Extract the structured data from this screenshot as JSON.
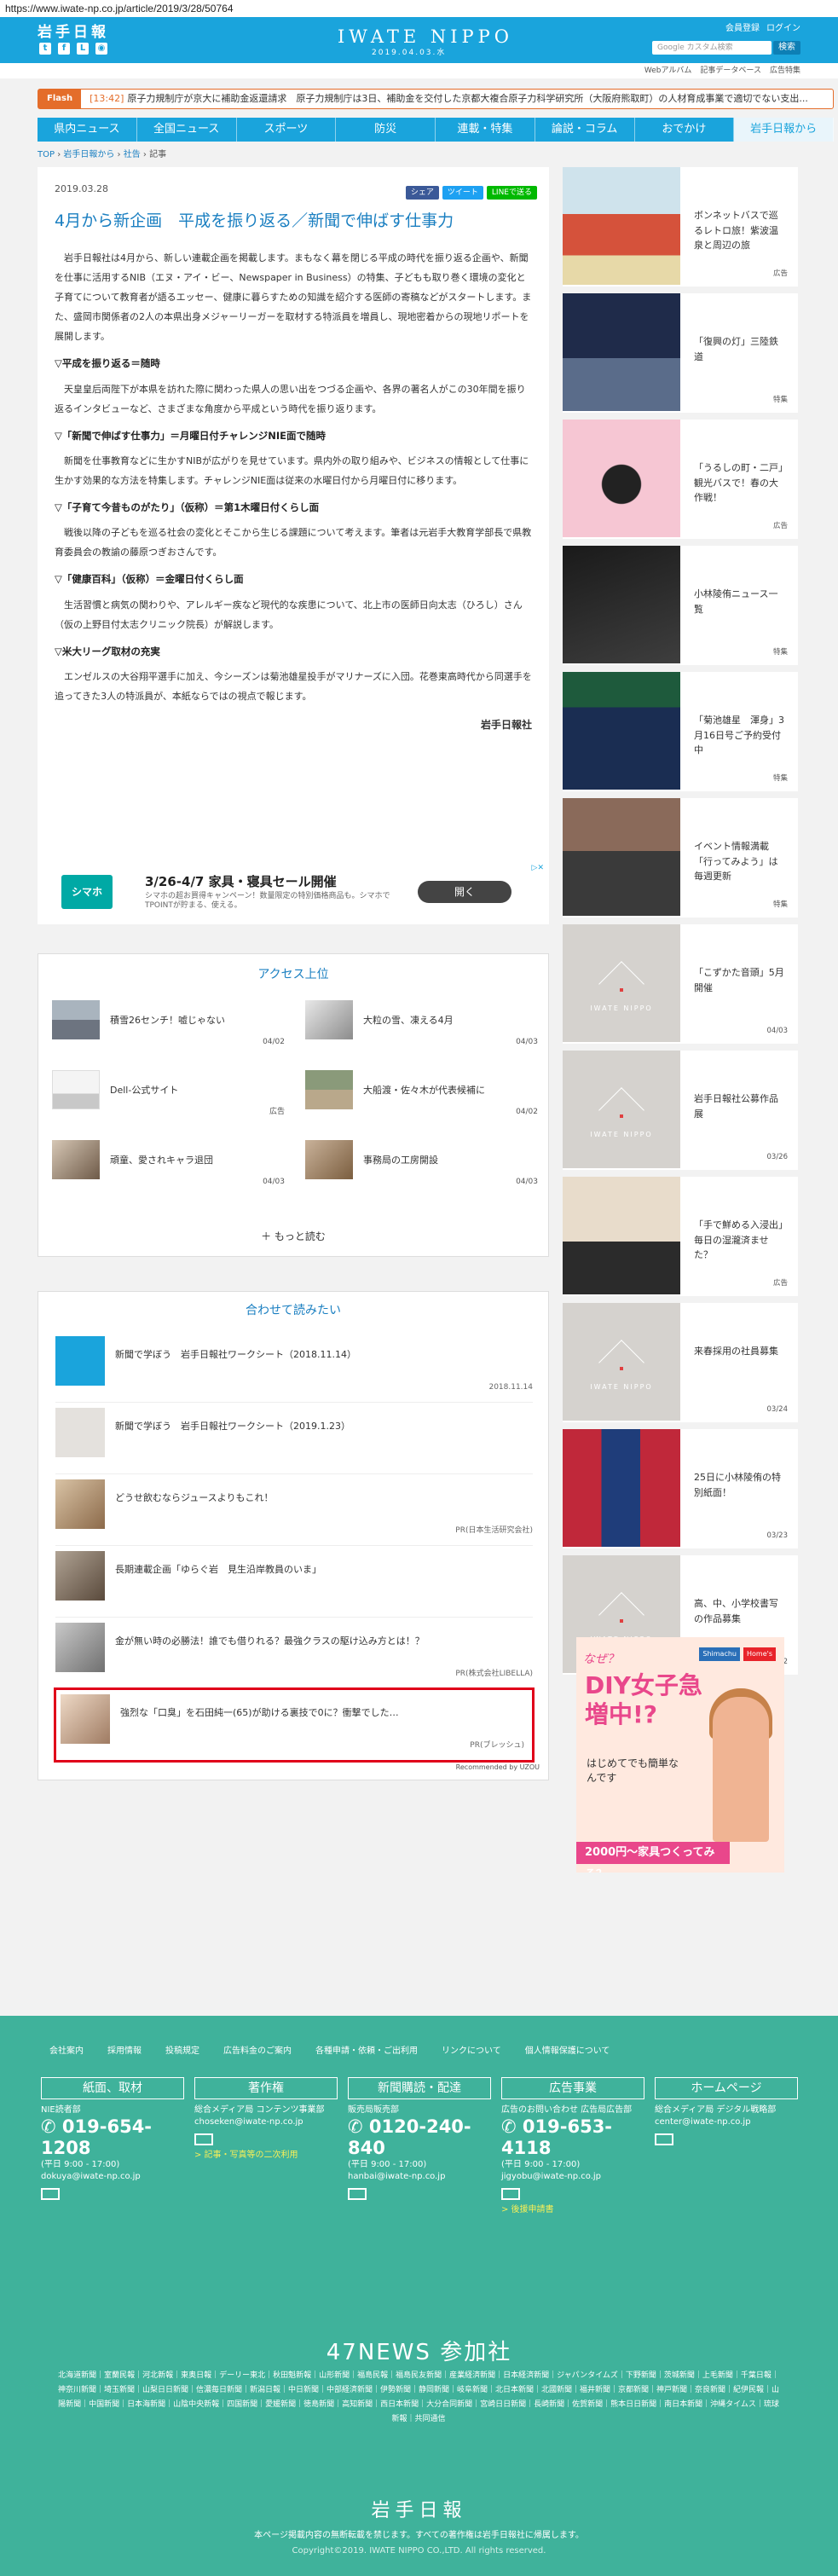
{
  "url": "https://www.iwate-np.co.jp/article/2019/3/28/50764",
  "header": {
    "logo_jp": "岩手日報",
    "logo_en": "IWATE NIPPO",
    "date": "2019.04.03.水",
    "member_register": "会員登録",
    "login": "ログイン",
    "search_placeholder": "Google カスタム検索",
    "search_button": "検索",
    "social": [
      "t",
      "f",
      "L",
      "rss"
    ]
  },
  "subnav": [
    "Webアルバム",
    "記事データベース",
    "広告特集"
  ],
  "flash": {
    "tag": "Flash",
    "time": "[13:42]",
    "text": "原子力規制庁が京大に補助金返還請求　原子力規制庁は3日、補助金を交付した京都大複合原子力科学研究所（大阪府熊取町）の人材育成事業で適切でない支出..."
  },
  "mainnav": [
    "県内ニュース",
    "全国ニュース",
    "スポーツ",
    "防災",
    "連載・特集",
    "論説・コラム",
    "おでかけ",
    "岩手日報から"
  ],
  "breadcrumb": [
    "TOP",
    "岩手日報から",
    "社告",
    "記事"
  ],
  "article": {
    "date": "2019.03.28",
    "share": [
      "シェア",
      "ツイート",
      "LINEで送る"
    ],
    "title": "4月から新企画　平成を振り返る／新聞で伸ばす仕事力",
    "intro": "岩手日報社は4月から、新しい連載企画を掲載します。まもなく幕を閉じる平成の時代を振り返る企画や、新聞を仕事に活用するNIB（エヌ・アイ・ビー、Newspaper in Business）の特集、子どもも取り巻く環境の変化と子育てについて教育者が語るエッセー、健康に暮らすための知識を紹介する医師の寄稿などがスタートします。また、盛岡市関係者の2人の本県出身メジャーリーガーを取材する特派員を増員し、現地密着からの現地リポートを展開します。",
    "sections": [
      {
        "heading": "▽平成を振り返る＝随時",
        "body": "天皇皇后両陛下が本県を訪れた際に関わった県人の思い出をつづる企画や、各界の著名人がこの30年間を振り返るインタビューなど、さまざまな角度から平成という時代を振り返ります。"
      },
      {
        "heading": "▽「新聞で伸ばす仕事力」＝月曜日付チャレンジNIE面で随時",
        "body": "新聞を仕事教育などに生かすNIBが広がりを見せています。県内外の取り組みや、ビジネスの情報として仕事に生かす効果的な方法を特集します。チャレンジNIE面は従来の水曜日付から月曜日付に移ります。"
      },
      {
        "heading": "▽「子育て今昔ものがたり」（仮称）＝第1木曜日付くらし面",
        "body": "戦後以降の子どもを巡る社会の変化とそこから生じる課題について考えます。筆者は元岩手大教育学部長で県教育委員会の教諭の藤原つぎおさんです。"
      },
      {
        "heading": "▽「健康百科」（仮称）＝金曜日付くらし面",
        "body": "生活習慣と病気の関わりや、アレルギー疾など現代的な疾患について、北上市の医師日向太志（ひろし）さん（仮の上野目付太志クリニック院長）が解説します。"
      },
      {
        "heading": "▽米大リーグ取材の充実",
        "body": "エンゼルスの大谷翔平選手に加え、今シーズンは菊池雄星投手がマリナーズに入団。花巻東高時代から同選手を追ってきた3人の特派員が、本紙ならではの視点で報じます。"
      }
    ],
    "signature": "岩手日報社"
  },
  "ad": {
    "logo": "シマホ",
    "headline": "3/26-4/7 家具・寝具セール開催",
    "desc": "シマホの超お買得キャンペーン！数量限定の特別価格商品も。シマホでTPOINTが貯まる、使える。",
    "button": "開く"
  },
  "ranking": {
    "title": "アクセス上位",
    "items": [
      {
        "label": "積雪26センチ！嘘じゃない",
        "date": "04/02"
      },
      {
        "label": "大粒の雪、凍える4月",
        "date": "04/03"
      },
      {
        "label": "Dell-公式サイト",
        "date": "広告"
      },
      {
        "label": "大船渡・佐々木が代表候補に",
        "date": "04/02"
      },
      {
        "label": "頑童、愛されキャラ退団",
        "date": "04/03"
      },
      {
        "label": "事務局の工房開設",
        "date": "04/03"
      }
    ],
    "more": "もっと読む"
  },
  "related": {
    "title": "合わせて読みたい",
    "items": [
      {
        "label": "新聞で学ぼう　岩手日報社ワークシート（2018.11.14）",
        "meta": "2018.11.14"
      },
      {
        "label": "新聞で学ぼう　岩手日報社ワークシート（2019.1.23）",
        "meta": ""
      },
      {
        "label": "どうせ飲むならジュースよりもこれ！",
        "meta": "PR(日本生活研究会社)"
      },
      {
        "label": "長期連載企画「ゆらぐ岩　見生沿岸教員のいま」",
        "meta": ""
      },
      {
        "label": "金が無い時の必勝法！誰でも借りれる？最強クラスの駆け込み方とは！？",
        "meta": "PR(株式会社LIBELLA)"
      },
      {
        "label": "強烈な「口臭」を石田純一(65)が助ける裏技で0に？衝撃でした…",
        "meta": "PR(ブレッシュ)"
      }
    ],
    "recommended": "Recommended by UZOU"
  },
  "sidebar": [
    {
      "label": "ボンネットバスで巡るレトロ旅！紫波温泉と周辺の旅",
      "meta": "広告"
    },
    {
      "label": "「復興の灯」三陸鉄道",
      "meta": "特集"
    },
    {
      "label": "「うるしの町・二戸」観光バスで！春の大作戦！",
      "meta": "広告"
    },
    {
      "label": "小林陵侑ニュース一覧",
      "meta": "特集"
    },
    {
      "label": "「菊池雄星　渾身」3月16日号ご予約受付中",
      "meta": "特集"
    },
    {
      "label": "イベント情報満載「行ってみよう」は毎週更新",
      "meta": "特集"
    },
    {
      "label": "「こずかた音頭」5月開催",
      "meta": "04/03"
    },
    {
      "label": "岩手日報社公募作品展",
      "meta": "03/26"
    },
    {
      "label": "「手で鮮める入浸出」毎日の湿瀧済ませた？",
      "meta": "広告"
    },
    {
      "label": "来春採用の社員募集",
      "meta": "03/24"
    },
    {
      "label": "25日に小林陵侑の特別紙面！",
      "meta": "03/23"
    },
    {
      "label": "高、中、小学校書写の作品募集",
      "meta": "03/22"
    }
  ],
  "diy_ad": {
    "why": "なぜ？",
    "headline": "DIY女子急増中!?",
    "sub": "はじめてでも簡単なんです",
    "bar": "2000円〜家具つくってみる？",
    "stores": [
      "Shimachu",
      "Home's"
    ]
  },
  "footer": {
    "links": [
      "会社案内",
      "採用情報",
      "投稿規定",
      "広告料金のご案内",
      "各種申請・依頼・ご出利用",
      "リンクについて",
      "個人情報保護について"
    ],
    "columns": [
      {
        "head": "紙面、取材",
        "dept": "NIE読者部",
        "phone": "019-654-1208",
        "hours": "(平日 9:00 - 17:00)",
        "email": "dokuya@iwate-np.co.jp",
        "note": ""
      },
      {
        "head": "著作権",
        "dept": "総合メディア局 コンテンツ事業部",
        "phone": "",
        "hours": "",
        "email": "choseken@iwate-np.co.jp",
        "note": "> 記事・写真等の二次利用"
      },
      {
        "head": "新聞購読・配達",
        "dept": "販売局販売部",
        "phone": "0120-240-840",
        "hours": "(平日 9:00 - 17:00)",
        "email": "hanbai@iwate-np.co.jp",
        "note": ""
      },
      {
        "head": "広告事業",
        "dept": "広告のお問い合わせ 広告局広告部",
        "phone": "019-653-4118",
        "hours": "(平日 9:00 - 17:00)",
        "email": "jigyobu@iwate-np.co.jp",
        "note": "> 後援申請書"
      },
      {
        "head": "ホームページ",
        "dept": "総合メディア局 デジタル戦略部",
        "phone": "",
        "hours": "",
        "email": "center@iwate-np.co.jp",
        "note": ""
      }
    ],
    "n47": "47NEWS 参加社",
    "papers": "北海道新聞｜室蘭民報｜河北新報｜東奥日報｜デーリー東北｜秋田魁新報｜山形新聞｜福島民報｜福島民友新聞｜産業経済新聞｜日本経済新聞｜ジャパンタイムズ｜下野新聞｜茨城新聞｜上毛新聞｜千葉日報｜神奈川新聞｜埼玉新聞｜山梨日日新聞｜信濃毎日新聞｜新潟日報｜中日新聞｜中部経済新聞｜伊勢新聞｜静岡新聞｜岐阜新聞｜北日本新聞｜北國新聞｜福井新聞｜京都新聞｜神戸新聞｜奈良新聞｜紀伊民報｜山陽新聞｜中国新聞｜日本海新聞｜山陰中央新報｜四国新聞｜愛媛新聞｜徳島新聞｜高知新聞｜西日本新聞｜大分合同新聞｜宮崎日日新聞｜長崎新聞｜佐賀新聞｜熊本日日新聞｜南日本新聞｜沖縄タイムス｜琉球新報｜共同通信",
    "logo": "岩手日報",
    "notice": "本ページ掲載内容の無断転載を禁じます。すべての著作権は岩手日報社に帰属します。",
    "copyright": "Copyright©2019. IWATE NIPPO CO.,LTD. All rights reserved."
  }
}
